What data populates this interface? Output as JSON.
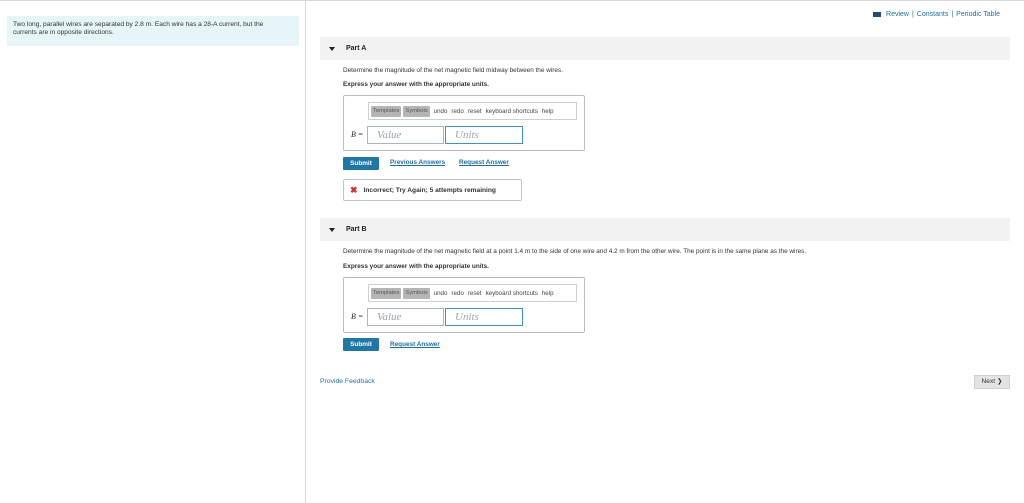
{
  "problem": {
    "text_line1": "Two long, parallel wires are separated by 2.8 m. Each wire has a 28-A current, but the",
    "text_line2": "currents are in opposite directions."
  },
  "top_links": {
    "review": "Review",
    "constants": "Constants",
    "periodic": "Periodic Table",
    "separator": "|"
  },
  "toolbar": {
    "templates": "Templates",
    "symbols": "Symbols",
    "undo": "undo",
    "redo": "redo",
    "reset": "reset",
    "shortcuts": "keyboard shortcuts",
    "help": "help"
  },
  "part_a": {
    "title": "Part A",
    "question": "Determine the magnitude of the net magnetic field midway between the wires.",
    "instruction": "Express your answer with the appropriate units.",
    "var_label": "B =",
    "value_placeholder": "Value",
    "units_placeholder": "Units",
    "submit": "Submit",
    "previous_answers": "Previous Answers",
    "request_answer": "Request Answer",
    "feedback": "Incorrect; Try Again; 5 attempts remaining"
  },
  "part_b": {
    "title": "Part B",
    "question": "Determine the magnitude of the net magnetic field at a point 1.4 m to the side of one wire and 4.2 m from the other wire. The point is in the same plane as the wires.",
    "instruction": "Express your answer with the appropriate units.",
    "var_label": "B =",
    "value_placeholder": "Value",
    "units_placeholder": "Units",
    "submit": "Submit",
    "request_answer": "Request Answer"
  },
  "footer": {
    "provide_feedback": "Provide Feedback",
    "next": "Next",
    "next_arrow": "❯"
  }
}
